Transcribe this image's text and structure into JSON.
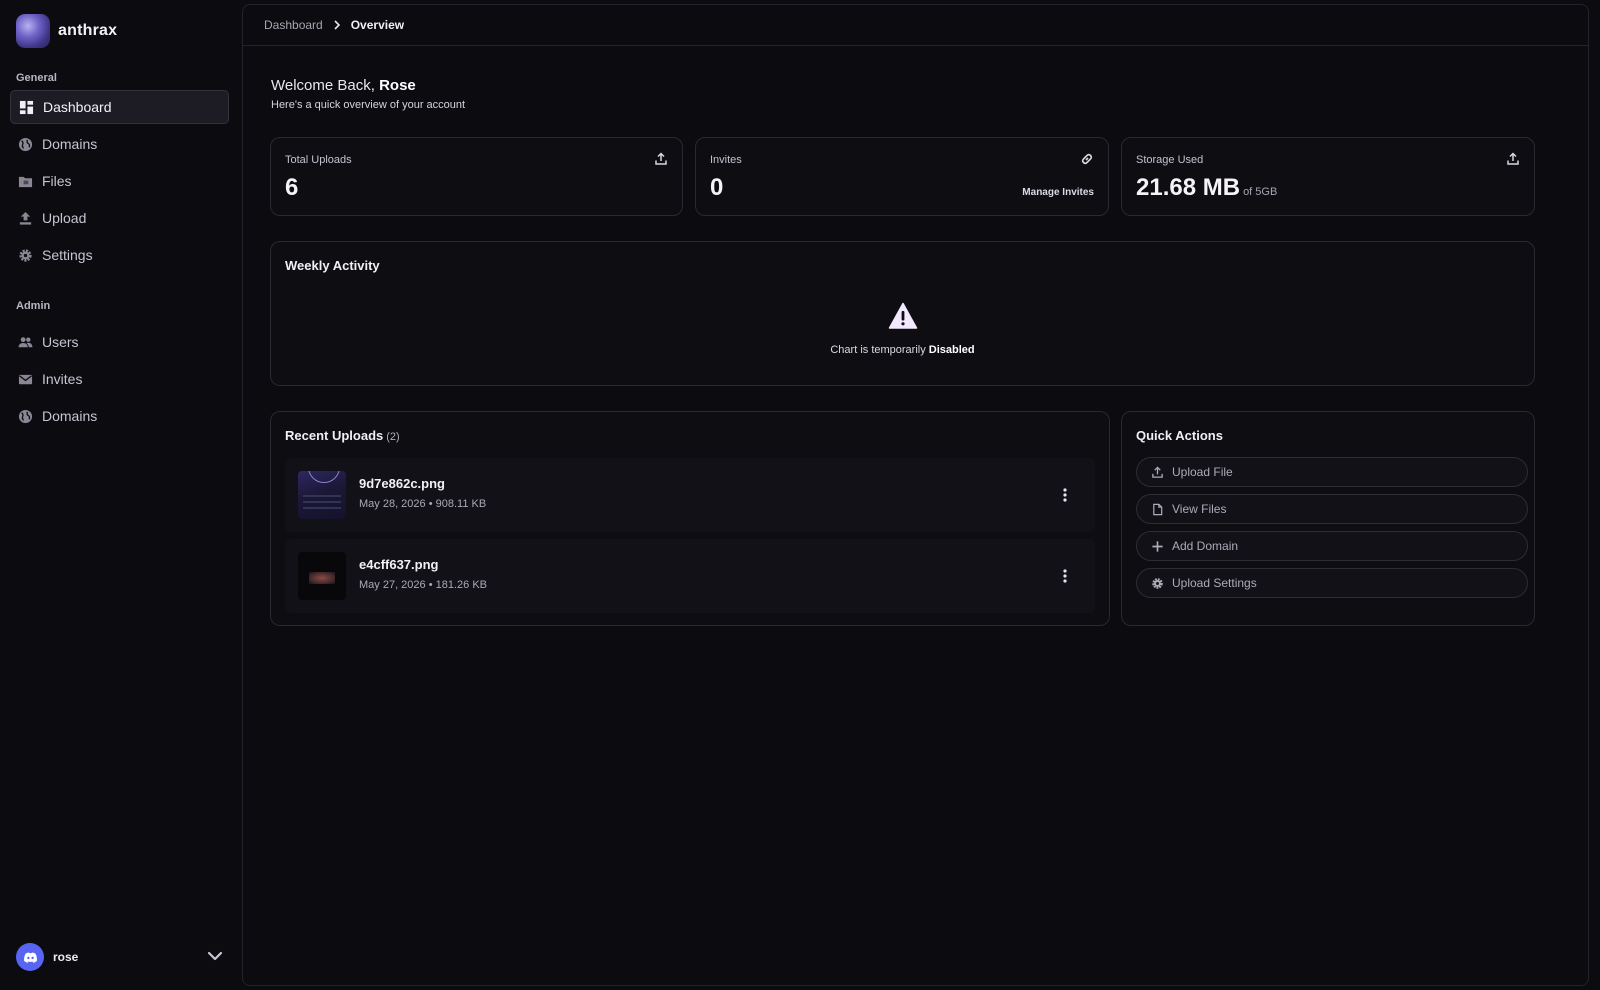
{
  "brand": {
    "name": "anthrax"
  },
  "sidebar": {
    "general_label": "General",
    "general_items": [
      {
        "label": "Dashboard",
        "icon": "dashboard-icon",
        "active": true
      },
      {
        "label": "Domains",
        "icon": "globe-icon"
      },
      {
        "label": "Files",
        "icon": "folder-icon"
      },
      {
        "label": "Upload",
        "icon": "upload-icon"
      },
      {
        "label": "Settings",
        "icon": "gear-icon"
      }
    ],
    "admin_label": "Admin",
    "admin_items": [
      {
        "label": "Users",
        "icon": "users-icon"
      },
      {
        "label": "Invites",
        "icon": "mail-icon"
      },
      {
        "label": "Domains",
        "icon": "globe-icon"
      }
    ]
  },
  "user": {
    "name": "rose",
    "avatar_icon": "discord-icon"
  },
  "breadcrumb": {
    "parent": "Dashboard",
    "current": "Overview"
  },
  "welcome": {
    "prefix": "Welcome Back, ",
    "name": "Rose",
    "subtitle": "Here's a quick overview of your account"
  },
  "stats": {
    "uploads": {
      "label": "Total Uploads",
      "value": "6",
      "icon": "upload-icon"
    },
    "invites": {
      "label": "Invites",
      "value": "0",
      "icon": "link-icon",
      "action": "Manage Invites"
    },
    "storage": {
      "label": "Storage Used",
      "value": "21.68 MB",
      "unit": "of 5GB",
      "icon": "upload-icon"
    }
  },
  "weekly": {
    "title": "Weekly Activity",
    "message_prefix": "Chart is temporarily ",
    "message_emphasis": "Disabled",
    "icon": "warning-icon"
  },
  "recent": {
    "title": "Recent Uploads",
    "count": "(2)",
    "items": [
      {
        "name": "9d7e862c.png",
        "meta": "May 28, 2026 • 908.11 KB"
      },
      {
        "name": "e4cff637.png",
        "meta": "May 27, 2026 • 181.26 KB"
      }
    ]
  },
  "quick_actions": {
    "title": "Quick Actions",
    "items": [
      {
        "label": "Upload File",
        "icon": "upload-icon"
      },
      {
        "label": "View Files",
        "icon": "file-icon"
      },
      {
        "label": "Add Domain",
        "icon": "plus-icon"
      },
      {
        "label": "Upload Settings",
        "icon": "gear-icon"
      }
    ]
  },
  "colors": {
    "background": "#0c0b10",
    "card": "#0e0d12",
    "border": "#2a2831",
    "accent": "#5865f2",
    "warning_icon": "#f3e9ff"
  }
}
